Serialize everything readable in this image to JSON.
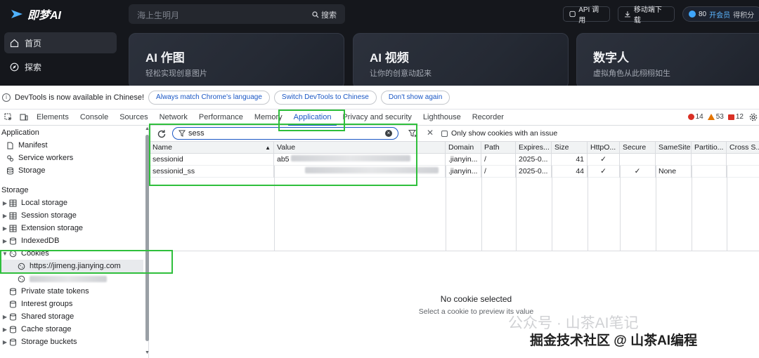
{
  "app": {
    "logo_text": "即梦AI",
    "search_placeholder": "海上生明月",
    "search_button": "搜索",
    "api_button": "API 调用",
    "download_button": "移动端下载",
    "points_value": "80",
    "points_cta": "开会员",
    "points_cta2": "得积分",
    "nav": [
      {
        "label": "首页",
        "icon": "home-icon",
        "active": true
      },
      {
        "label": "探索",
        "icon": "explore-icon",
        "active": false
      }
    ],
    "cards": [
      {
        "title": "AI 作图",
        "subtitle": "轻松实现创意图片"
      },
      {
        "title": "AI 视频",
        "subtitle": "让你的创意动起来"
      },
      {
        "title": "数字人",
        "subtitle": "虚拟角色从此栩栩如生"
      }
    ]
  },
  "devtools": {
    "infobar": {
      "message": "DevTools is now available in Chinese!",
      "btn_match": "Always match Chrome's language",
      "btn_switch": "Switch DevTools to Chinese",
      "btn_dismiss": "Don't show again"
    },
    "tabs": [
      "Elements",
      "Console",
      "Sources",
      "Network",
      "Performance",
      "Memory",
      "Application",
      "Privacy and security",
      "Lighthouse",
      "Recorder"
    ],
    "active_tab": "Application",
    "badges": {
      "errors": "14",
      "warnings": "53",
      "issues": "12"
    },
    "tree": {
      "app_header": "Application",
      "app_items": [
        "Manifest",
        "Service workers",
        "Storage"
      ],
      "storage_header": "Storage",
      "storage_items": [
        "Local storage",
        "Session storage",
        "Extension storage",
        "IndexedDB"
      ],
      "cookies_label": "Cookies",
      "cookie_origin": "https://jimeng.jianying.com",
      "other_items": [
        "Private state tokens",
        "Interest groups",
        "Shared storage",
        "Cache storage",
        "Storage buckets"
      ]
    },
    "cookies": {
      "filter_value": "sess",
      "only_issue_label": "Only show cookies with an issue",
      "columns": [
        "Name",
        "Value",
        "Domain",
        "Path",
        "Expires...",
        "Size",
        "HttpO...",
        "Secure",
        "SameSite",
        "Partitio...",
        "Cross S..."
      ],
      "rows": [
        {
          "name": "sessionid",
          "value": "ab5",
          "domain": ".jianyin...",
          "path": "/",
          "expires": "2025-0...",
          "size": "41",
          "httponly": "✓",
          "secure": "",
          "samesite": ""
        },
        {
          "name": "sessionid_ss",
          "value": "",
          "domain": ".jianyin...",
          "path": "/",
          "expires": "2025-0...",
          "size": "44",
          "httponly": "✓",
          "secure": "✓",
          "samesite": "None"
        }
      ],
      "empty_title": "No cookie selected",
      "empty_subtitle": "Select a cookie to preview its value"
    },
    "watermark_1": "公众号 · 山茶AI笔记",
    "watermark_2": "掘金技术社区 @ 山茶AI编程"
  },
  "colors": {
    "highlight": "#2fbf3c",
    "accent": "#1a57c5",
    "app_bg": "#15171c"
  }
}
